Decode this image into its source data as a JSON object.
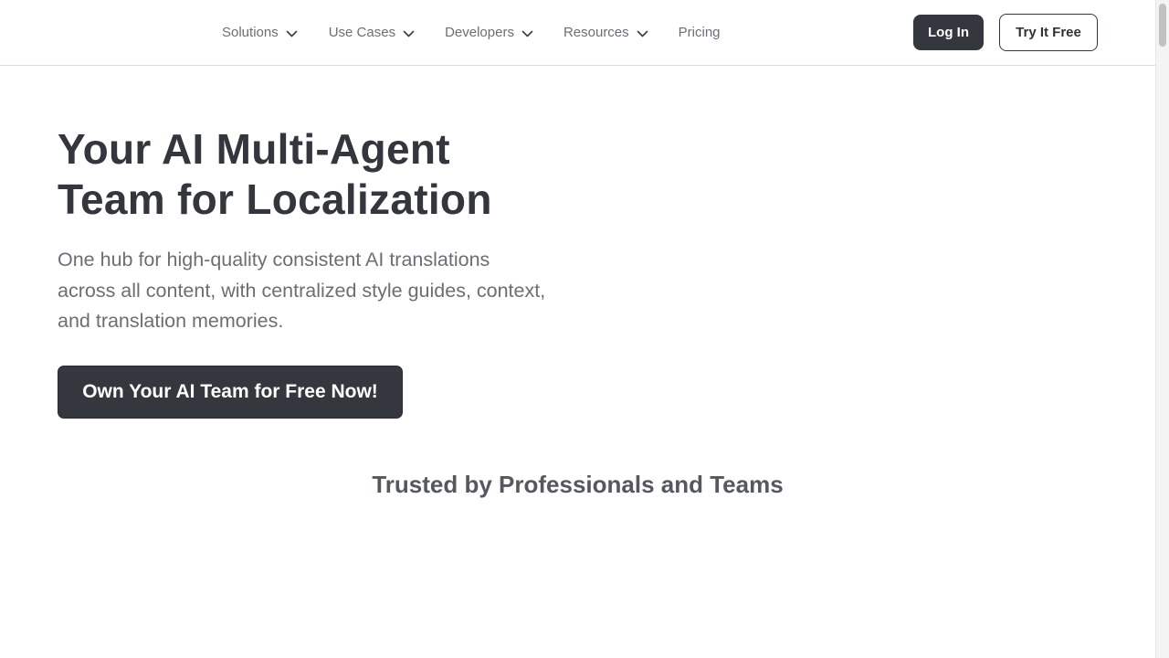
{
  "nav": {
    "items": [
      {
        "label": "Solutions",
        "has_dropdown": true
      },
      {
        "label": "Use Cases",
        "has_dropdown": true
      },
      {
        "label": "Developers",
        "has_dropdown": true
      },
      {
        "label": "Resources",
        "has_dropdown": true
      },
      {
        "label": "Pricing",
        "has_dropdown": false
      }
    ],
    "dropdown_icon": "chevron-down-icon"
  },
  "header": {
    "login_label": "Log In",
    "try_label": "Try It Free"
  },
  "hero": {
    "title_line1": "Your AI Multi-Agent",
    "title_line2": "Team for Localization",
    "subtitle": "One hub for high-quality consistent AI translations across all content, with centralized style guides, context, and translation memories.",
    "cta_label": "Own Your AI Team for Free Now!"
  },
  "trusted": {
    "heading": "Trusted by Professionals and Teams"
  },
  "colors": {
    "primary_dark": "#34373d",
    "text_muted": "#6b6e74",
    "background": "#ffffff"
  }
}
